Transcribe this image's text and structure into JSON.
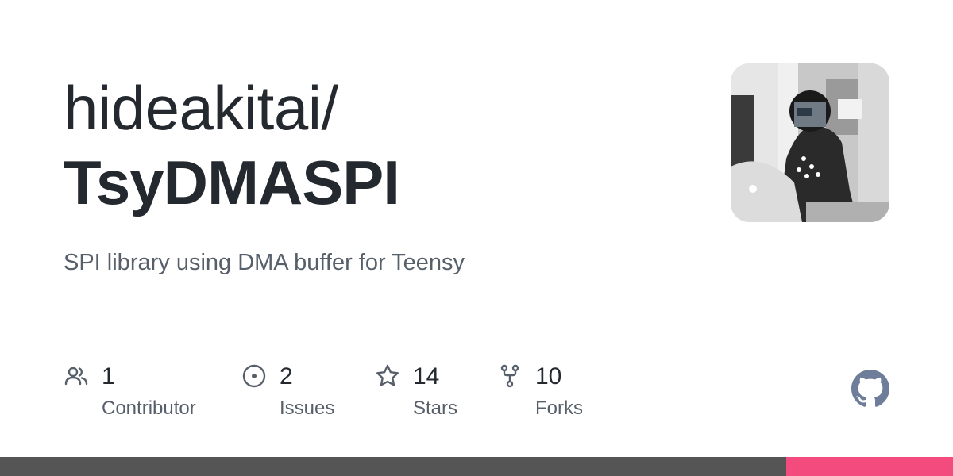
{
  "repo": {
    "owner": "hideakitai/",
    "name": "TsyDMASPI",
    "description": "SPI library using DMA buffer for Teensy"
  },
  "avatar": {
    "icon": "user-avatar-photo"
  },
  "stats": [
    {
      "icon": "people-icon",
      "count": "1",
      "label": "Contributor"
    },
    {
      "icon": "issue-opened-icon",
      "count": "2",
      "label": "Issues"
    },
    {
      "icon": "star-icon",
      "count": "14",
      "label": "Stars"
    },
    {
      "icon": "repo-forked-icon",
      "count": "10",
      "label": "Forks"
    }
  ],
  "branding": {
    "icon": "github-mark-icon",
    "color": "#6e7d99"
  },
  "language_bar": [
    {
      "share": 0.825,
      "color": "#555555"
    },
    {
      "share": 0.175,
      "color": "#f34b7d"
    }
  ],
  "colors": {
    "text_primary": "#24292f",
    "text_secondary": "#57606a",
    "icon": "#57606a"
  }
}
